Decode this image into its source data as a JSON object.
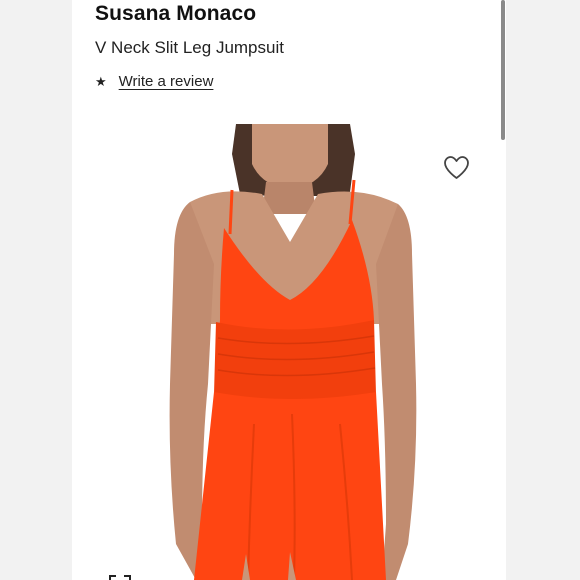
{
  "product": {
    "brand": "Susana Monaco",
    "name": "V Neck Slit Leg Jumpsuit",
    "rating_star": "★",
    "review_link": "Write a review"
  },
  "image": {
    "subject": "model wearing orange v-neck jumpsuit",
    "garment_color": "#ff4512",
    "skin_color": "#c99679",
    "hair_color": "#4a3328"
  },
  "icons": {
    "wishlist": "heart-outline-icon",
    "gallery": "gallery-expand-icon"
  }
}
